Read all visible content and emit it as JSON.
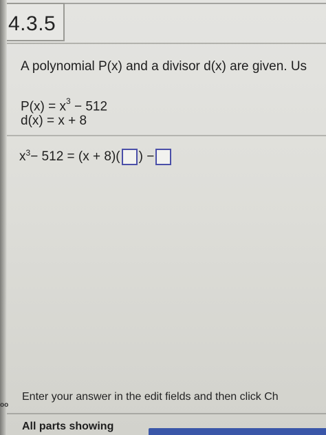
{
  "header": {
    "section_number": "4.3.5"
  },
  "problem": {
    "statement": "A polynomial P(x) and a divisor d(x) are given. Us",
    "p_lhs": "P(x) = x",
    "p_exp": "3",
    "p_rhs": " − 512",
    "d_text": "d(x) = x + 8"
  },
  "answer": {
    "lhs_base": "x",
    "lhs_exp": "3",
    "lhs_rest": " − 512 = (x + 8)(",
    "middle": ") − ",
    "quotient_value": "",
    "remainder_value": ""
  },
  "footer": {
    "instruction": "Enter your answer in the edit fields and then click Ch",
    "parts_label": "All parts showing",
    "side_fragment": "oo"
  },
  "colors": {
    "edit_box_border": "#4a4fa8",
    "button_blue": "#3a56a8"
  }
}
